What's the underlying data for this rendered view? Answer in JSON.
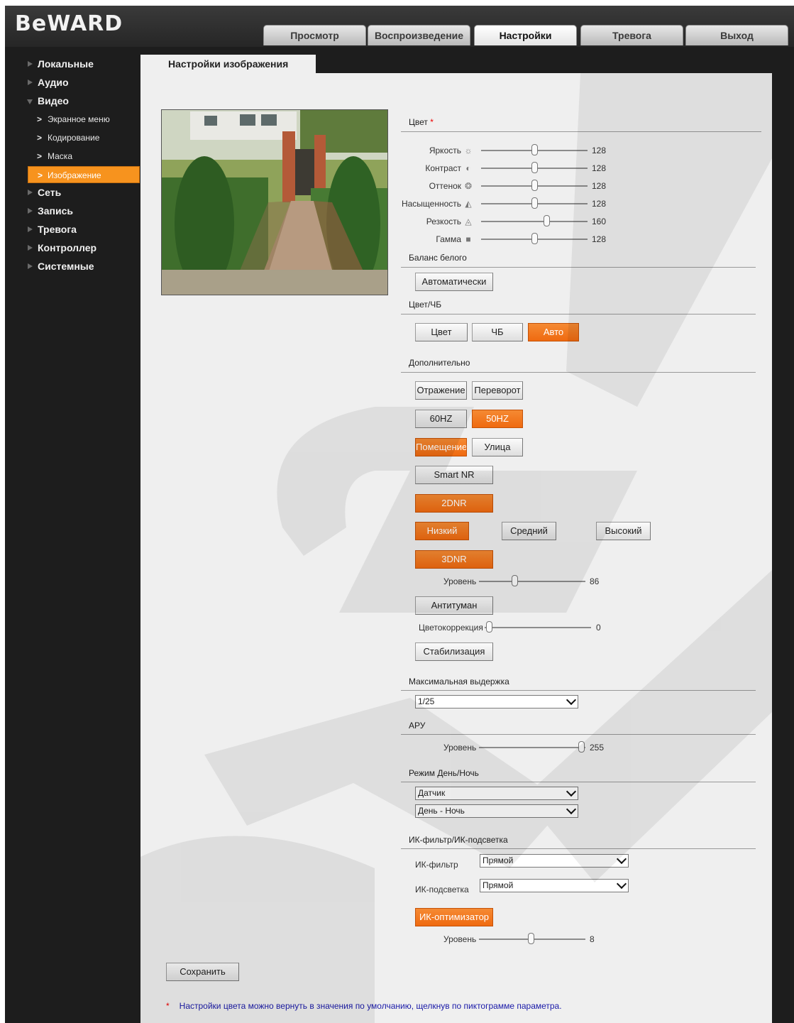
{
  "brand": {
    "logo": "BeWARD"
  },
  "tabs": [
    {
      "label": "Просмотр",
      "active": false
    },
    {
      "label": "Воспроизведение",
      "active": false
    },
    {
      "label": "Настройки",
      "active": true
    },
    {
      "label": "Тревога",
      "active": false
    },
    {
      "label": "Выход",
      "active": false
    }
  ],
  "sidebar": {
    "items": [
      {
        "label": "Локальные"
      },
      {
        "label": "Аудио"
      },
      {
        "label": "Видео",
        "expanded": true
      },
      {
        "label": "Сеть"
      },
      {
        "label": "Запись"
      },
      {
        "label": "Тревога"
      },
      {
        "label": "Контроллер"
      },
      {
        "label": "Системные"
      }
    ],
    "video_sub": [
      {
        "label": "Экранное меню"
      },
      {
        "label": "Кодирование"
      },
      {
        "label": "Маска"
      },
      {
        "label": "Изображение",
        "active": true
      }
    ]
  },
  "page": {
    "title": "Настройки изображения"
  },
  "color": {
    "title": "Цвет",
    "star": "*",
    "sliders": [
      {
        "label": "Яркость",
        "icon": "sun-icon",
        "value": 128,
        "max": 255
      },
      {
        "label": "Контраст",
        "icon": "contrast-icon",
        "value": 128,
        "max": 255
      },
      {
        "label": "Оттенок",
        "icon": "palette-icon",
        "value": 128,
        "max": 255
      },
      {
        "label": "Насыщенность",
        "icon": "saturation-icon",
        "value": 128,
        "max": 255
      },
      {
        "label": "Резкость",
        "icon": "sharpness-icon",
        "value": 160,
        "max": 255
      },
      {
        "label": "Гамма",
        "icon": "gamma-icon",
        "value": 128,
        "max": 255
      }
    ]
  },
  "white_balance": {
    "title": "Баланс белого",
    "button": "Автоматически"
  },
  "color_bw": {
    "title": "Цвет/ЧБ",
    "buttons": [
      "Цвет",
      "ЧБ",
      "Авто"
    ],
    "active": "Авто"
  },
  "extra": {
    "title": "Дополнительно",
    "mirror": "Отражение",
    "flip": "Переворот",
    "hz60": "60HZ",
    "hz50": "50HZ",
    "indoor": "Помещение",
    "outdoor": "Улица",
    "smart_nr": "Smart NR",
    "dnr2": "2DNR",
    "low": "Низкий",
    "medium": "Средний",
    "high": "Высокий",
    "dnr3": "3DNR",
    "level_label": "Уровень",
    "dnr3_level": 86,
    "dnr3_max": 255,
    "defog": "Антитуман",
    "colorcorr_label": "Цветокоррекция",
    "colorcorr_value": 0,
    "stabilization": "Стабилизация"
  },
  "exposure": {
    "title": "Максимальная выдержка",
    "value": "1/25"
  },
  "agc": {
    "title": "АРУ",
    "level_label": "Уровень",
    "value": 255,
    "max": 255
  },
  "daynight": {
    "title": "Режим День/Ночь",
    "mode": "Датчик",
    "schedule": "День - Ночь"
  },
  "ir": {
    "title": "ИК-фильтр/ИК-подсветка",
    "filter_label": "ИК-фильтр",
    "filter_value": "Прямой",
    "light_label": "ИК-подсветка",
    "light_value": "Прямой",
    "optimizer": "ИК-оптимизатор",
    "level_label": "Уровень",
    "level_value": 8,
    "level_max": 20
  },
  "save": "Сохранить",
  "note": {
    "star": "*",
    "text": "Настройки цвета можно вернуть в значения по умолчанию, щелкнув по пиктограмме параметра."
  },
  "colors": {
    "accent": "#f7931e",
    "button_on": "#f07018",
    "background": "#1d1d1d",
    "panel": "#efefef"
  }
}
